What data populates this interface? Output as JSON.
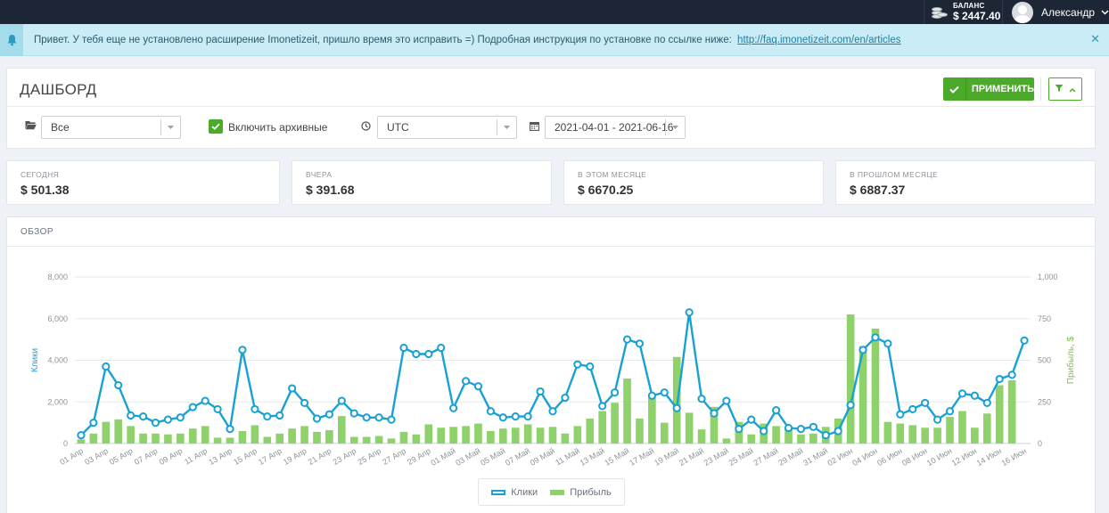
{
  "topbar": {
    "balance_label": "БАЛАНС",
    "balance_value": "$ 2447.40",
    "user_name": "Александр"
  },
  "alert": {
    "text": "Привет. У тебя еще не установлено расширение Imonetizeit, пришло время это исправить =) Подробная инструкция по установке по ссылке ниже:",
    "link_text": "http://faq.imonetizeit.com/en/articles"
  },
  "header": {
    "title": "ДАШБОРД",
    "apply_label": "ПРИМЕНИТЬ"
  },
  "filters": {
    "scope_value": "Все",
    "include_archived_label": "Включить архивные",
    "include_archived_checked": true,
    "timezone_value": "UTC",
    "date_range_value": "2021-04-01 - 2021-06-16"
  },
  "stats": [
    {
      "label": "СЕГОДНЯ",
      "value": "$ 501.38"
    },
    {
      "label": "ВЧЕРА",
      "value": "$ 391.68"
    },
    {
      "label": "В ЭТОМ МЕСЯЦЕ",
      "value": "$ 6670.25"
    },
    {
      "label": "В ПРОШЛОМ МЕСЯЦЕ",
      "value": "$ 6887.37"
    }
  ],
  "colors": {
    "clicks_line": "#1aa1d3",
    "profit_bar": "#8fd16a",
    "accent_green": "#4caa2a"
  },
  "chart_data": {
    "type": "bar+line",
    "title": "ОБЗОР",
    "y_left_label": "Клики",
    "y_right_label": "Прибыль, $",
    "y_left_range": [
      0,
      8000
    ],
    "y_left_ticks": [
      "0",
      "2,000",
      "4,000",
      "6,000",
      "8,000"
    ],
    "y_right_range": [
      0,
      1000
    ],
    "y_right_ticks": [
      "0",
      "250",
      "500",
      "750",
      "1,000"
    ],
    "grid": true,
    "legend_position": "bottom-center",
    "x_tick_labels": [
      "01 Апр",
      "03 Апр",
      "05 Апр",
      "07 Апр",
      "09 Апр",
      "11 Апр",
      "13 Апр",
      "15 Апр",
      "17 Апр",
      "19 Апр",
      "21 Апр",
      "23 Апр",
      "25 Апр",
      "27 Апр",
      "29 Апр",
      "01 Май",
      "03 Май",
      "05 Май",
      "07 Май",
      "09 Май",
      "11 Май",
      "13 Май",
      "15 Май",
      "17 Май",
      "19 Май",
      "21 Май",
      "23 Май",
      "25 Май",
      "27 Май",
      "29 Май",
      "31 Май",
      "02 Июн",
      "04 Июн",
      "06 Июн",
      "08 Июн",
      "10 Июн",
      "12 Июн",
      "14 Июн",
      "16 Июн"
    ],
    "series": [
      {
        "name": "Клики",
        "axis": "left",
        "type": "line",
        "values": [
          400,
          1000,
          3700,
          2800,
          1350,
          1300,
          1000,
          1150,
          1250,
          1750,
          2050,
          1650,
          700,
          4500,
          1650,
          1300,
          1350,
          2650,
          1950,
          1200,
          1400,
          2050,
          1450,
          1250,
          1250,
          1150,
          4600,
          4300,
          4300,
          4600,
          1700,
          3000,
          2750,
          1550,
          1250,
          1300,
          1300,
          2500,
          1550,
          2200,
          3800,
          3700,
          1800,
          2450,
          5000,
          4800,
          2300,
          2450,
          1700,
          6300,
          2150,
          1450,
          2050,
          700,
          1150,
          600,
          1600,
          750,
          700,
          800,
          400,
          600,
          1850,
          4500,
          5100,
          4800,
          1400,
          1650,
          1950,
          1150,
          1550,
          2400,
          2300,
          1950,
          3100,
          3300,
          4950
        ]
      },
      {
        "name": "Прибыль",
        "axis": "right",
        "type": "bar",
        "values": [
          25,
          60,
          130,
          145,
          105,
          60,
          60,
          55,
          60,
          90,
          105,
          35,
          35,
          75,
          110,
          40,
          60,
          90,
          105,
          70,
          80,
          165,
          40,
          40,
          45,
          30,
          70,
          55,
          115,
          95,
          100,
          105,
          120,
          75,
          90,
          95,
          115,
          95,
          100,
          60,
          105,
          150,
          195,
          245,
          390,
          150,
          290,
          125,
          520,
          185,
          85,
          220,
          30,
          130,
          55,
          120,
          105,
          90,
          55,
          60,
          100,
          150,
          775,
          585,
          690,
          130,
          120,
          110,
          95,
          95,
          160,
          195,
          95,
          180,
          350,
          380
        ]
      }
    ]
  }
}
